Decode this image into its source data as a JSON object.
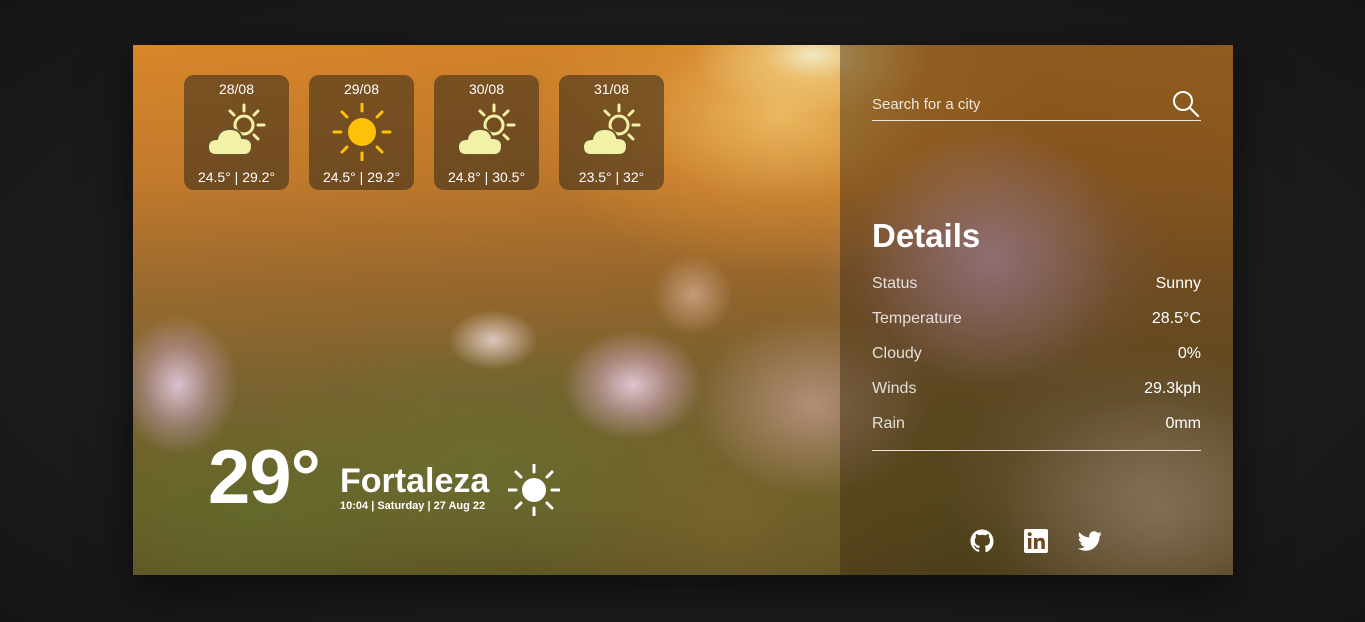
{
  "forecast": [
    {
      "date": "28/08",
      "icon": "partly-cloudy-icon",
      "temps": "24.5° | 29.2°"
    },
    {
      "date": "29/08",
      "icon": "sun-icon",
      "temps": "24.5° | 29.2°"
    },
    {
      "date": "30/08",
      "icon": "partly-cloudy-icon",
      "temps": "24.8° | 30.5°"
    },
    {
      "date": "31/08",
      "icon": "partly-cloudy-icon",
      "temps": "23.5° | 32°"
    }
  ],
  "current": {
    "temperature": "29°",
    "city": "Fortaleza",
    "datetime": "10:04 | Saturday | 27 Aug 22",
    "icon": "sun-icon"
  },
  "search": {
    "placeholder": "Search for a city",
    "icon": "search-icon"
  },
  "details": {
    "title": "Details",
    "rows": [
      {
        "label": "Status",
        "value": "Sunny"
      },
      {
        "label": "Temperature",
        "value": "28.5°C"
      },
      {
        "label": "Cloudy",
        "value": "0%"
      },
      {
        "label": "Winds",
        "value": "29.3kph"
      },
      {
        "label": "Rain",
        "value": "0mm"
      }
    ]
  },
  "socials": [
    "github-icon",
    "linkedin-icon",
    "twitter-icon"
  ],
  "colors": {
    "sun": "#ffc107",
    "cloud": "#f3f1a6",
    "text": "#ffffff",
    "panel_overlay": "rgba(60,40,15,0.45)"
  }
}
